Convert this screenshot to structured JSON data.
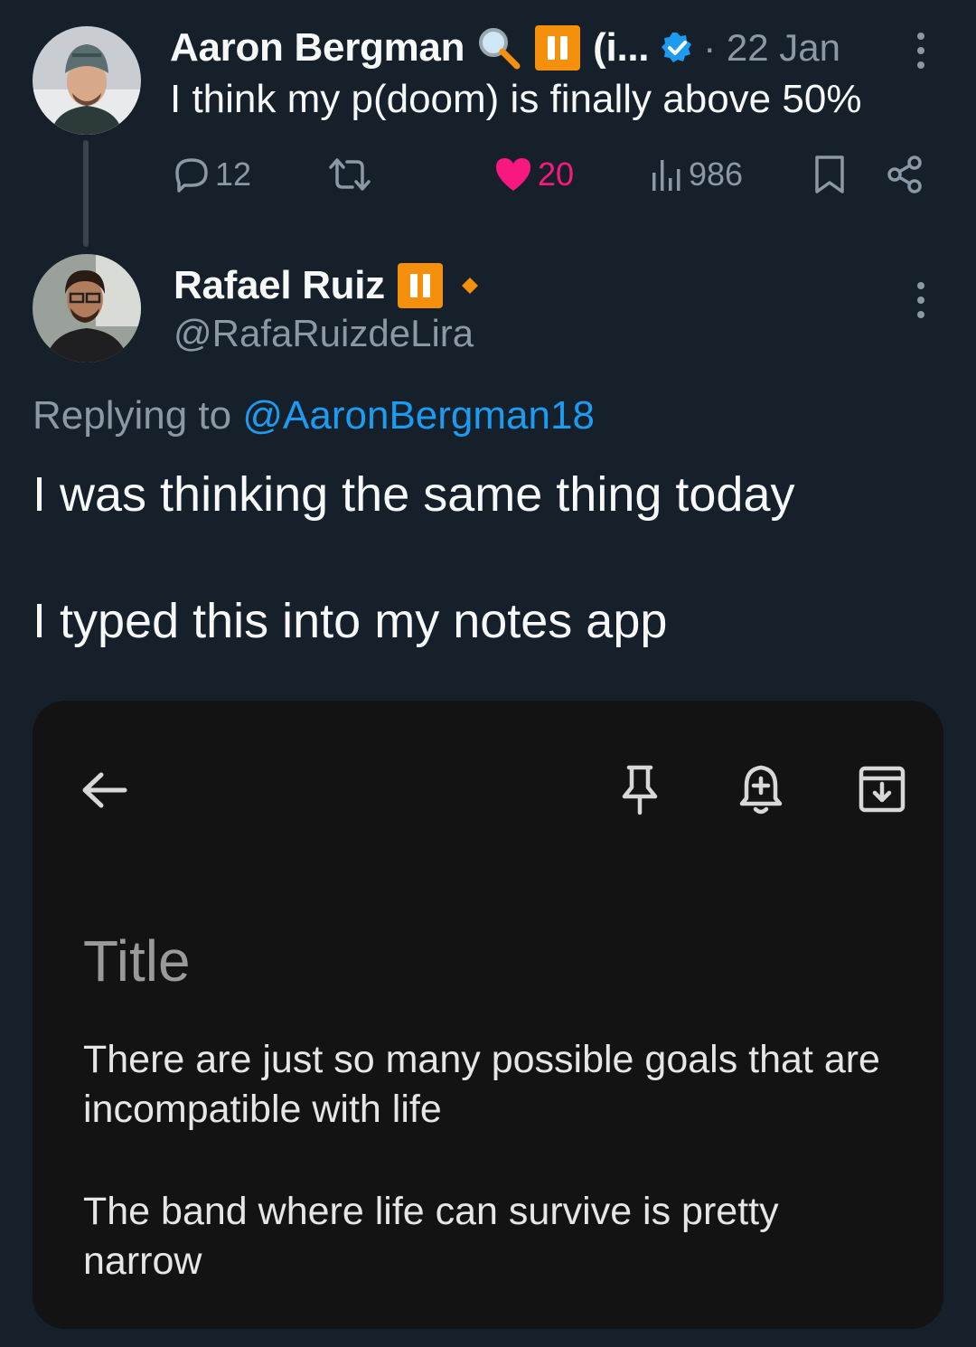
{
  "original_tweet": {
    "author_name": "Aaron Bergman",
    "name_suffix": "(i...",
    "date": "· 22 Jan",
    "text": "I think my p(doom) is finally above 50%",
    "stats": {
      "replies": "12",
      "likes": "20",
      "views": "986"
    },
    "colors": {
      "like": "#f91880",
      "verified": "#1d9bf0",
      "badge": "#f4900c"
    }
  },
  "reply_tweet": {
    "author_name": "Rafael Ruiz",
    "handle": "@RafaRuizdeLira",
    "replying_prefix": "Replying to",
    "replying_handle": "@AaronBergman18",
    "line1": "I was thinking the same thing today",
    "line2": "I typed this into my notes app"
  },
  "notes_screenshot": {
    "title_placeholder": "Title",
    "paragraph1": "There are just so many possible goals that are incompatible with life",
    "paragraph2": "The band where life can survive is pretty narrow",
    "icons": [
      "back-arrow-icon",
      "pin-icon",
      "reminder-bell-icon",
      "archive-icon"
    ]
  }
}
